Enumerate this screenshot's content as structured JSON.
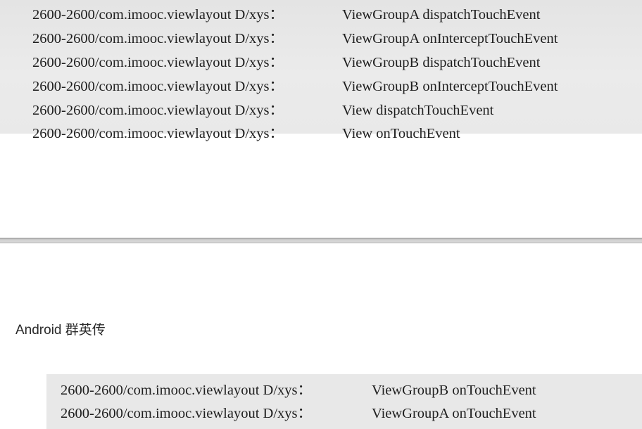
{
  "top_log": {
    "lines": [
      {
        "tag": "2600-2600/com.imooc.viewlayout D/xys：",
        "msg": "ViewGroupA dispatchTouchEvent"
      },
      {
        "tag": "2600-2600/com.imooc.viewlayout D/xys：",
        "msg": "ViewGroupA onInterceptTouchEvent"
      },
      {
        "tag": "2600-2600/com.imooc.viewlayout D/xys：",
        "msg": "ViewGroupB dispatchTouchEvent"
      },
      {
        "tag": "2600-2600/com.imooc.viewlayout D/xys：",
        "msg": "ViewGroupB onInterceptTouchEvent"
      },
      {
        "tag": "2600-2600/com.imooc.viewlayout D/xys：",
        "msg": "View dispatchTouchEvent"
      },
      {
        "tag": "2600-2600/com.imooc.viewlayout D/xys：",
        "msg": "View onTouchEvent"
      }
    ]
  },
  "running_header": "Android 群英传",
  "bottom_log": {
    "lines": [
      {
        "tag": "2600-2600/com.imooc.viewlayout D/xys：",
        "msg": "ViewGroupB onTouchEvent"
      },
      {
        "tag": "2600-2600/com.imooc.viewlayout D/xys：",
        "msg": "ViewGroupA onTouchEvent"
      }
    ]
  }
}
